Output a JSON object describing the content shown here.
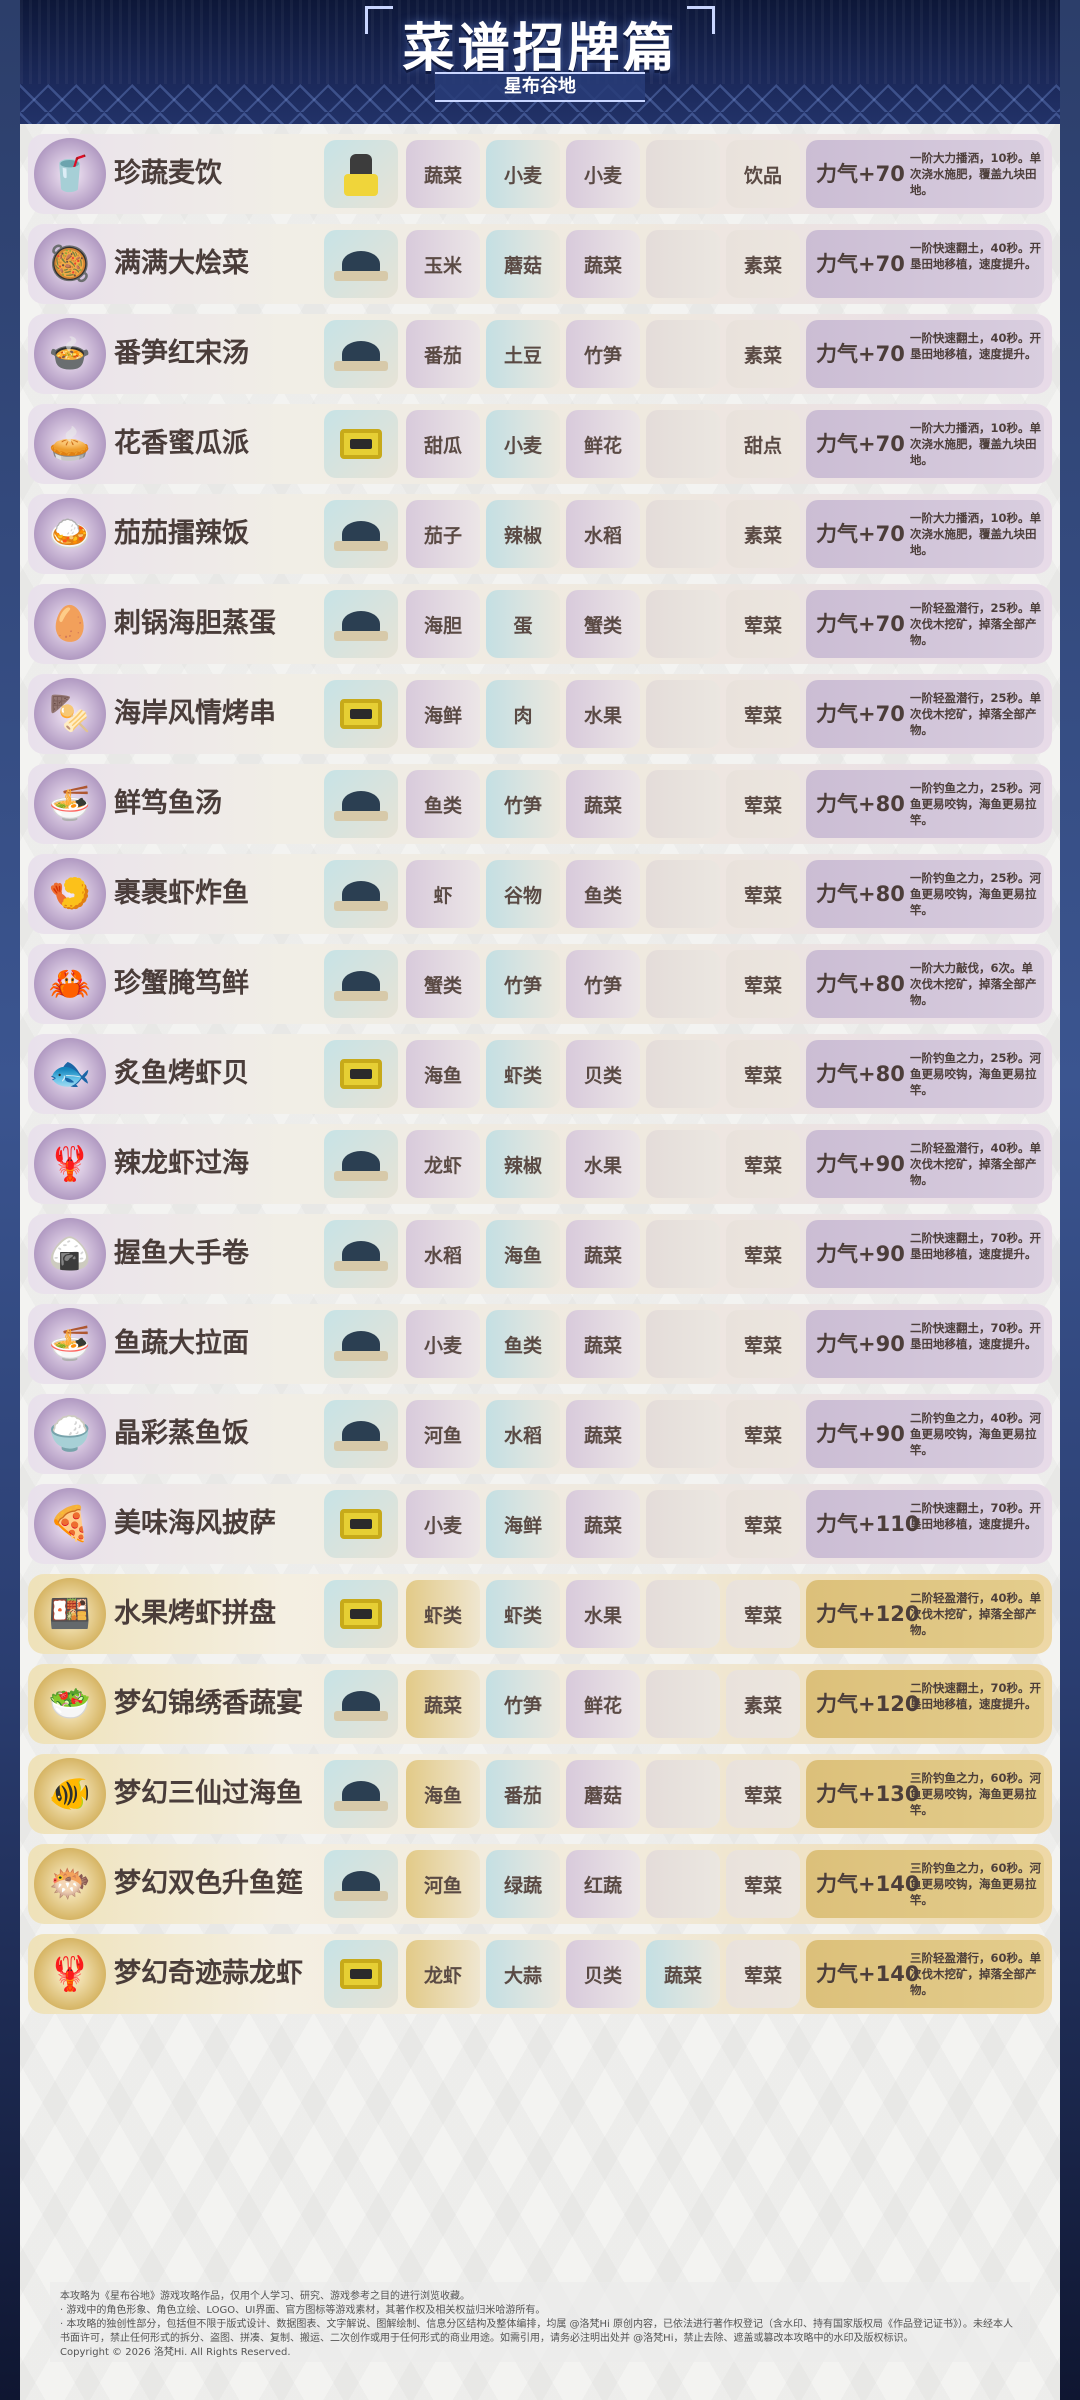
{
  "header": {
    "title": "菜谱招牌篇",
    "subtitle": "星布谷地"
  },
  "recipes": [
    {
      "name": "珍蔬麦饮",
      "icon": "🥤",
      "appliance": "blender",
      "ing": [
        "蔬菜",
        "小麦",
        "小麦",
        ""
      ],
      "cat": "饮品",
      "power": "力气+70",
      "desc": "一阶大力播洒，10秒。单次浇水施肥，覆盖九块田地。",
      "gold": false
    },
    {
      "name": "满满大烩菜",
      "icon": "🥘",
      "appliance": "pot",
      "ing": [
        "玉米",
        "蘑菇",
        "蔬菜",
        ""
      ],
      "cat": "素菜",
      "power": "力气+70",
      "desc": "一阶快速翻土，40秒。开垦田地移植，速度提升。",
      "gold": false
    },
    {
      "name": "番笋红宋汤",
      "icon": "🍲",
      "appliance": "pot",
      "ing": [
        "番茄",
        "土豆",
        "竹笋",
        ""
      ],
      "cat": "素菜",
      "power": "力气+70",
      "desc": "一阶快速翻土，40秒。开垦田地移植，速度提升。",
      "gold": false
    },
    {
      "name": "花香蜜瓜派",
      "icon": "🥧",
      "appliance": "oven",
      "ing": [
        "甜瓜",
        "小麦",
        "鲜花",
        ""
      ],
      "cat": "甜点",
      "power": "力气+70",
      "desc": "一阶大力播洒，10秒。单次浇水施肥，覆盖九块田地。",
      "gold": false
    },
    {
      "name": "茄茄擂辣饭",
      "icon": "🍛",
      "appliance": "pot",
      "ing": [
        "茄子",
        "辣椒",
        "水稻",
        ""
      ],
      "cat": "素菜",
      "power": "力气+70",
      "desc": "一阶大力播洒，10秒。单次浇水施肥，覆盖九块田地。",
      "gold": false
    },
    {
      "name": "刺锅海胆蒸蛋",
      "icon": "🥚",
      "appliance": "pot",
      "ing": [
        "海胆",
        "蛋",
        "蟹类",
        ""
      ],
      "cat": "荤菜",
      "power": "力气+70",
      "desc": "一阶轻盈潜行，25秒。单次伐木挖矿，掉落全部产物。",
      "gold": false
    },
    {
      "name": "海岸风情烤串",
      "icon": "🍢",
      "appliance": "oven",
      "ing": [
        "海鲜",
        "肉",
        "水果",
        ""
      ],
      "cat": "荤菜",
      "power": "力气+70",
      "desc": "一阶轻盈潜行，25秒。单次伐木挖矿，掉落全部产物。",
      "gold": false
    },
    {
      "name": "鲜笃鱼汤",
      "icon": "🍜",
      "appliance": "pot",
      "ing": [
        "鱼类",
        "竹笋",
        "蔬菜",
        ""
      ],
      "cat": "荤菜",
      "power": "力气+80",
      "desc": "一阶钓鱼之力，25秒。河鱼更易咬钩，海鱼更易拉竿。",
      "gold": false
    },
    {
      "name": "裹裹虾炸鱼",
      "icon": "🍤",
      "appliance": "pot",
      "ing": [
        "虾",
        "谷物",
        "鱼类",
        ""
      ],
      "cat": "荤菜",
      "power": "力气+80",
      "desc": "一阶钓鱼之力，25秒。河鱼更易咬钩，海鱼更易拉竿。",
      "gold": false
    },
    {
      "name": "珍蟹腌笃鲜",
      "icon": "🦀",
      "appliance": "pot",
      "ing": [
        "蟹类",
        "竹笋",
        "竹笋",
        ""
      ],
      "cat": "荤菜",
      "power": "力气+80",
      "desc": "一阶大力敲伐，6次。单次伐木挖矿，掉落全部产物。",
      "gold": false
    },
    {
      "name": "炙鱼烤虾贝",
      "icon": "🐟",
      "appliance": "oven",
      "ing": [
        "海鱼",
        "虾类",
        "贝类",
        ""
      ],
      "cat": "荤菜",
      "power": "力气+80",
      "desc": "一阶钓鱼之力，25秒。河鱼更易咬钩，海鱼更易拉竿。",
      "gold": false
    },
    {
      "name": "辣龙虾过海",
      "icon": "🦞",
      "appliance": "pot",
      "ing": [
        "龙虾",
        "辣椒",
        "水果",
        ""
      ],
      "cat": "荤菜",
      "power": "力气+90",
      "desc": "二阶轻盈潜行，40秒。单次伐木挖矿，掉落全部产物。",
      "gold": false
    },
    {
      "name": "握鱼大手卷",
      "icon": "🍙",
      "appliance": "pot",
      "ing": [
        "水稻",
        "海鱼",
        "蔬菜",
        ""
      ],
      "cat": "荤菜",
      "power": "力气+90",
      "desc": "二阶快速翻土，70秒。开垦田地移植，速度提升。",
      "gold": false
    },
    {
      "name": "鱼蔬大拉面",
      "icon": "🍜",
      "appliance": "pot",
      "ing": [
        "小麦",
        "鱼类",
        "蔬菜",
        ""
      ],
      "cat": "荤菜",
      "power": "力气+90",
      "desc": "二阶快速翻土，70秒。开垦田地移植，速度提升。",
      "gold": false
    },
    {
      "name": "晶彩蒸鱼饭",
      "icon": "🍚",
      "appliance": "pot",
      "ing": [
        "河鱼",
        "水稻",
        "蔬菜",
        ""
      ],
      "cat": "荤菜",
      "power": "力气+90",
      "desc": "二阶钓鱼之力，40秒。河鱼更易咬钩，海鱼更易拉竿。",
      "gold": false
    },
    {
      "name": "美味海风披萨",
      "icon": "🍕",
      "appliance": "oven",
      "ing": [
        "小麦",
        "海鲜",
        "蔬菜",
        ""
      ],
      "cat": "荤菜",
      "power": "力气+110",
      "desc": "二阶快速翻土，70秒。开垦田地移植，速度提升。",
      "gold": false
    },
    {
      "name": "水果烤虾拼盘",
      "icon": "🍱",
      "appliance": "oven",
      "ing": [
        "虾类",
        "虾类",
        "水果",
        ""
      ],
      "cat": "荤菜",
      "power": "力气+120",
      "desc": "二阶轻盈潜行，40秒。单次伐木挖矿，掉落全部产物。",
      "gold": true
    },
    {
      "name": "梦幻锦绣香蔬宴",
      "icon": "🥗",
      "appliance": "pot",
      "ing": [
        "蔬菜",
        "竹笋",
        "鲜花",
        ""
      ],
      "cat": "素菜",
      "power": "力气+120",
      "desc": "二阶快速翻土，70秒。开垦田地移植，速度提升。",
      "gold": true
    },
    {
      "name": "梦幻三仙过海鱼",
      "icon": "🐠",
      "appliance": "pot",
      "ing": [
        "海鱼",
        "番茄",
        "蘑菇",
        ""
      ],
      "cat": "荤菜",
      "power": "力气+130",
      "desc": "三阶钓鱼之力，60秒。河鱼更易咬钩，海鱼更易拉竿。",
      "gold": true
    },
    {
      "name": "梦幻双色升鱼筵",
      "icon": "🐡",
      "appliance": "pot",
      "ing": [
        "河鱼",
        "绿蔬",
        "红蔬",
        ""
      ],
      "cat": "荤菜",
      "power": "力气+140",
      "desc": "三阶钓鱼之力，60秒。河鱼更易咬钩，海鱼更易拉竿。",
      "gold": true
    },
    {
      "name": "梦幻奇迹蒜龙虾",
      "icon": "🦞",
      "appliance": "oven",
      "ing": [
        "龙虾",
        "大蒜",
        "贝类",
        "蔬菜"
      ],
      "cat": "荤菜",
      "power": "力气+140",
      "desc": "三阶轻盈潜行，60秒。单次伐木挖矿，掉落全部产物。",
      "gold": true
    }
  ],
  "footer": {
    "line1": "本攻略为《星布谷地》游戏攻略作品，仅用个人学习、研究、游戏参考之目的进行浏览收藏。",
    "line2": "· 游戏中的角色形象、角色立绘、LOGO、UI界面、官方图标等游戏素材，其著作权及相关权益归米哈游所有。",
    "line3": "· 本攻略的独创性部分，包括但不限于版式设计、数据图表、文字解说、图解绘制、信息分区结构及整体编排，均属 @洛梵Hi 原创内容，已依法进行著作权登记（含水印、持有国家版权局《作品登记证书》）。未经本人书面许可，禁止任何形式的拆分、盗图、拼凑、复制、搬运、二次创作或用于任何形式的商业用途。如需引用，请务必注明出处并 @洛梵Hi，禁止去除、遮盖或篡改本攻略中的水印及版权标识。",
    "line4": "Copyright © 2026 洛梵Hi. All Rights Reserved."
  }
}
